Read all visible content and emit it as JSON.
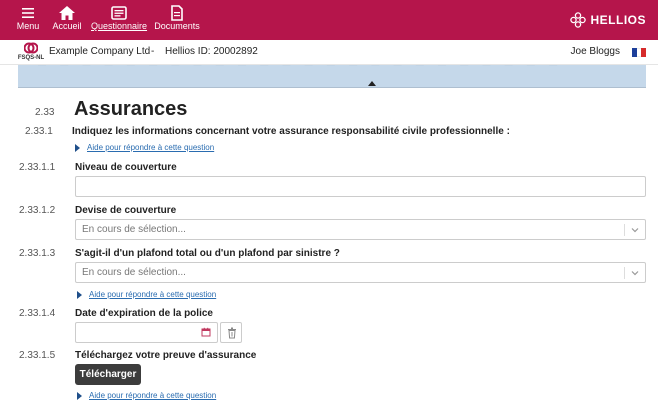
{
  "nav": {
    "menu": {
      "label": "Menu",
      "icon": "hamburger-icon"
    },
    "home": {
      "label": "Accueil",
      "icon": "home-icon"
    },
    "questionnaire": {
      "label": "Questionnaire",
      "icon": "questionnaire-icon"
    },
    "documents": {
      "label": "Documents",
      "icon": "document-icon"
    }
  },
  "brand": {
    "name": "HELLIOS"
  },
  "company": {
    "org_logo_text": "FSQS-NL",
    "name": "Example Company Ltd",
    "separator": "-",
    "hellios_id": "Hellios ID:  20002892",
    "user": "Joe Bloggs"
  },
  "colors": {
    "topbar": "#b5154b",
    "progress": "#c5d8ea",
    "link": "#2a6cb0",
    "button": "#3c3c3c"
  },
  "section": {
    "number": "2.33",
    "title": "Assurances"
  },
  "questions": {
    "q1": {
      "number": "2.33.1",
      "text": "Indiquez les informations concernant votre assurance responsabilité civile professionnelle :",
      "help": "Aide pour répondre à cette question"
    },
    "q11": {
      "number": "2.33.1.1",
      "text": "Niveau de couverture",
      "value": ""
    },
    "q12": {
      "number": "2.33.1.2",
      "text": "Devise de couverture",
      "select_value": "En cours de sélection..."
    },
    "q13": {
      "number": "2.33.1.3",
      "text": "S'agit-il d'un plafond total ou d'un plafond par sinistre ?",
      "select_value": "En cours de sélection...",
      "help": "Aide pour répondre à cette question"
    },
    "q14": {
      "number": "2.33.1.4",
      "text": "Date d'expiration de la police",
      "value": ""
    },
    "q15": {
      "number": "2.33.1.5",
      "text": "Téléchargez votre preuve d'assurance",
      "button": "Télécharger",
      "help": "Aide pour répondre à cette question"
    }
  }
}
